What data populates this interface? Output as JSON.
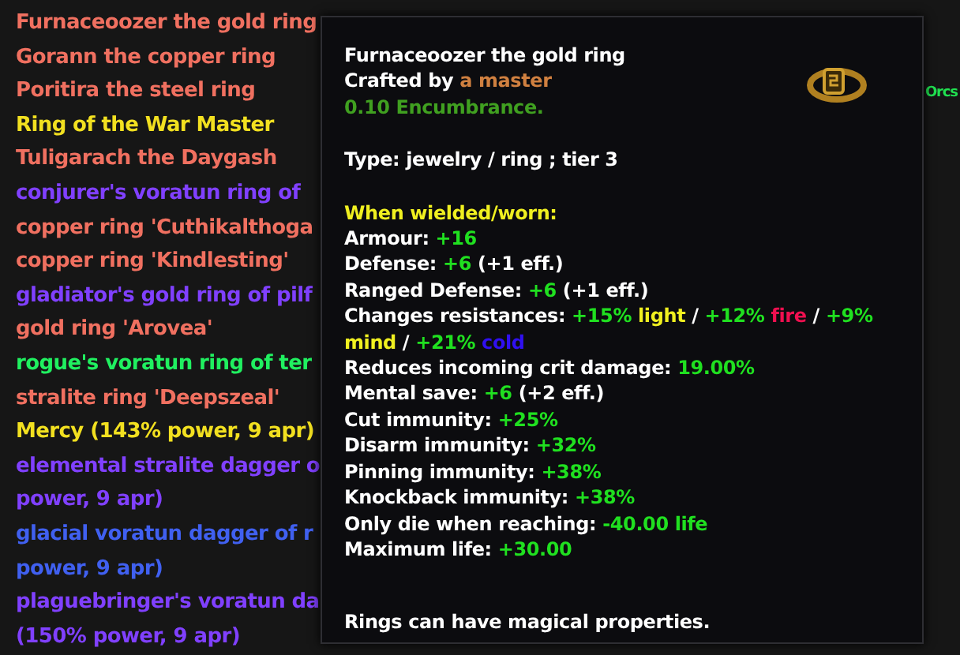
{
  "inventory": [
    {
      "lines": [
        "Furnaceoozer the gold ring"
      ],
      "color": "#f07060"
    },
    {
      "lines": [
        "Gorann the copper ring"
      ],
      "color": "#f07060"
    },
    {
      "lines": [
        "Poritira the steel ring"
      ],
      "color": "#f07060"
    },
    {
      "lines": [
        "Ring of the War Master"
      ],
      "color": "#f2e020"
    },
    {
      "lines": [
        "Tuligarach the Daygash"
      ],
      "color": "#f07060"
    },
    {
      "lines": [
        "conjurer's voratun ring of"
      ],
      "color": "#8040ff"
    },
    {
      "lines": [
        "copper ring 'Cuthikalthoga"
      ],
      "color": "#f07060"
    },
    {
      "lines": [
        "copper ring 'Kindlesting'"
      ],
      "color": "#f07060"
    },
    {
      "lines": [
        "gladiator's gold ring of pilf"
      ],
      "color": "#8040ff"
    },
    {
      "lines": [
        "gold ring 'Arovea'"
      ],
      "color": "#f07060"
    },
    {
      "lines": [
        "rogue's voratun ring of ter"
      ],
      "color": "#20f060"
    },
    {
      "lines": [
        "stralite ring 'Deepszeal'"
      ],
      "color": "#f07060"
    },
    {
      "lines": [
        "Mercy (143% power, 9 apr)"
      ],
      "color": "#f2e020"
    },
    {
      "lines": [
        "elemental stralite dagger o",
        "power, 9 apr)"
      ],
      "color": "#8040ff"
    },
    {
      "lines": [
        "glacial voratun dagger of r",
        "power, 9 apr)"
      ],
      "color": "#4060f0"
    },
    {
      "lines": [
        "plaguebringer's voratun da",
        "(150% power, 9 apr)"
      ],
      "color": "#8040ff"
    }
  ],
  "side_panel": {
    "text": "Orcs"
  },
  "tooltip": {
    "sections": [
      {
        "kind": "header",
        "lines": [
          [
            {
              "text": "Furnaceoozer the gold ring",
              "color": "#ffffff"
            }
          ],
          [
            {
              "text": "Crafted by ",
              "color": "#ffffff"
            },
            {
              "text": "a master",
              "color": "#d08040"
            }
          ],
          [
            {
              "text": "0.10 Encumbrance.",
              "color": "#40a020"
            }
          ]
        ]
      },
      {
        "kind": "body",
        "lines": [
          [
            {
              "text": "Type: jewelry / ring ; tier 3",
              "color": "#ffffff"
            }
          ]
        ]
      },
      {
        "kind": "body",
        "lines": [
          [
            {
              "text": "When wielded/worn:",
              "color": "#f0f020"
            }
          ],
          [
            {
              "text": "Armour: ",
              "color": "#ffffff"
            },
            {
              "text": "+16",
              "color": "#20e020"
            }
          ],
          [
            {
              "text": "Defense: ",
              "color": "#ffffff"
            },
            {
              "text": "+6",
              "color": "#20e020"
            },
            {
              "text": " (+1 eff.)",
              "color": "#ffffff"
            }
          ],
          [
            {
              "text": "Ranged Defense: ",
              "color": "#ffffff"
            },
            {
              "text": "+6",
              "color": "#20e020"
            },
            {
              "text": " (+1 eff.)",
              "color": "#ffffff"
            }
          ],
          [
            {
              "text": "Changes resistances: ",
              "color": "#ffffff"
            },
            {
              "text": "+15%",
              "color": "#20e020"
            },
            {
              "text": " light",
              "color": "#f0f020"
            },
            {
              "text": " / ",
              "color": "#ffffff"
            },
            {
              "text": "+12%",
              "color": "#20e020"
            },
            {
              "text": " fire",
              "color": "#f01050"
            },
            {
              "text": " / ",
              "color": "#ffffff"
            },
            {
              "text": "+9%",
              "color": "#20e020"
            },
            {
              "text": " mind",
              "color": "#f0f020"
            },
            {
              "text": " / ",
              "color": "#ffffff"
            },
            {
              "text": "+21%",
              "color": "#20e020"
            },
            {
              "text": " cold",
              "color": "#3010f0"
            }
          ],
          [
            {
              "text": "Reduces incoming crit damage: ",
              "color": "#ffffff"
            },
            {
              "text": "19.00%",
              "color": "#20e020"
            }
          ],
          [
            {
              "text": "Mental save: ",
              "color": "#ffffff"
            },
            {
              "text": "+6",
              "color": "#20e020"
            },
            {
              "text": " (+2 eff.)",
              "color": "#ffffff"
            }
          ],
          [
            {
              "text": "Cut immunity: ",
              "color": "#ffffff"
            },
            {
              "text": "+25%",
              "color": "#20e020"
            }
          ],
          [
            {
              "text": "Disarm immunity: ",
              "color": "#ffffff"
            },
            {
              "text": "+32%",
              "color": "#20e020"
            }
          ],
          [
            {
              "text": "Pinning immunity: ",
              "color": "#ffffff"
            },
            {
              "text": "+38%",
              "color": "#20e020"
            }
          ],
          [
            {
              "text": "Knockback immunity: ",
              "color": "#ffffff"
            },
            {
              "text": "+38%",
              "color": "#20e020"
            }
          ],
          [
            {
              "text": "Only die when reaching: ",
              "color": "#ffffff"
            },
            {
              "text": "-40.00 life",
              "color": "#20e020"
            }
          ],
          [
            {
              "text": "Maximum life: ",
              "color": "#ffffff"
            },
            {
              "text": "+30.00",
              "color": "#20e020"
            }
          ]
        ]
      },
      {
        "kind": "footer",
        "lines": [
          [
            {
              "text": "Rings can have magical properties.",
              "color": "#ffffff"
            }
          ]
        ]
      }
    ]
  }
}
